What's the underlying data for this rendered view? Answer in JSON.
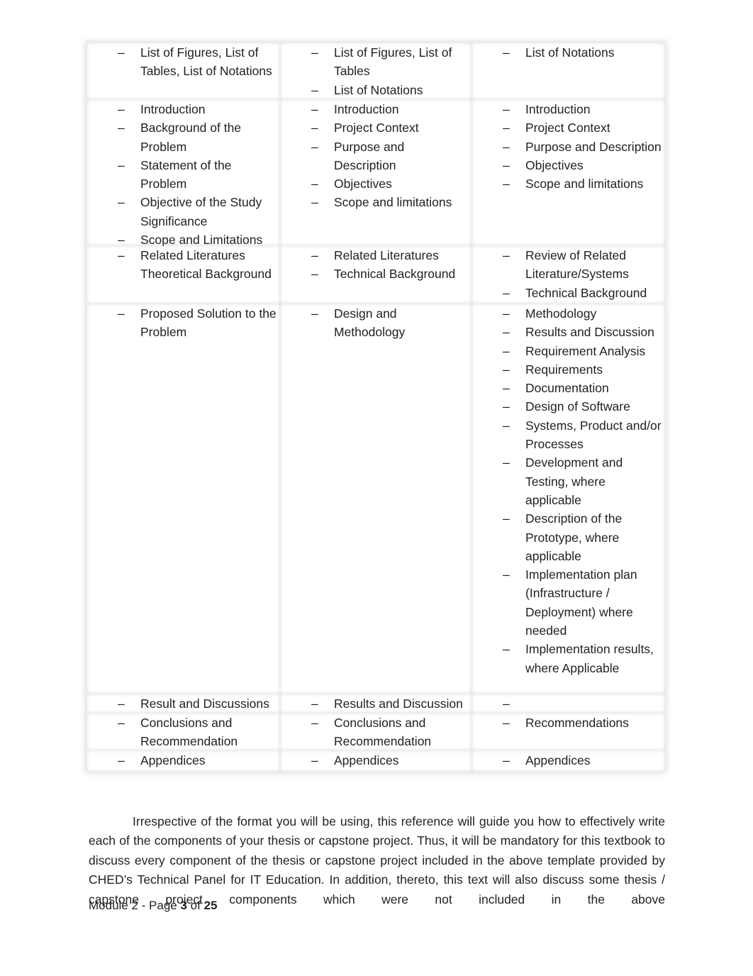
{
  "table": {
    "dash": "–",
    "rows": [
      [
        [
          "List of Figures, List of Tables, List of Notations"
        ],
        [
          "List of Figures, List of Tables",
          "List of Notations"
        ],
        [
          "List of Notations"
        ]
      ],
      [
        [
          "Introduction",
          "Background of the Problem",
          "Statement of the Problem",
          "Objective of the Study Significance",
          "Scope and Limitations"
        ],
        [
          "Introduction",
          "Project Context",
          "Purpose and Description",
          "Objectives",
          "Scope and limitations"
        ],
        [
          "Introduction",
          "Project Context",
          "Purpose and Description",
          "Objectives",
          "Scope and limitations"
        ]
      ],
      [
        [
          "Related Literatures Theoretical Background"
        ],
        [
          "Related Literatures",
          "Technical Background"
        ],
        [
          "Review of Related Literature/Systems",
          "Technical Background"
        ]
      ],
      [
        [
          "Proposed Solution to the Problem"
        ],
        [
          "Design and Methodology"
        ],
        [
          "Methodology",
          "Results and Discussion",
          "Requirement Analysis",
          "Requirements",
          "Documentation",
          "Design of Software",
          "Systems, Product and/or Processes",
          "Development and Testing, where applicable",
          "Description of the Prototype, where applicable",
          "Implementation plan (Infrastructure / Deployment) where needed",
          "Implementation results, where Applicable"
        ]
      ],
      [
        [
          "Result and Discussions"
        ],
        [
          "Results and Discussion"
        ],
        [
          ""
        ]
      ],
      [
        [
          "Conclusions and Recommendation"
        ],
        [
          "Conclusions and Recommendation"
        ],
        [
          "Recommendations"
        ]
      ],
      [
        [
          "Appendices"
        ],
        [
          "Appendices"
        ],
        [
          "Appendices"
        ]
      ]
    ]
  },
  "paragraph": "Irrespective of the format you will be using, this reference will guide you how to effectively write each of the components of your thesis or capstone project. Thus, it will be mandatory for this textbook to discuss every component of the thesis or capstone project included in the above template provided by CHED’s Technical Panel for IT Education. In addition, thereto, this text will also discuss some thesis / capstone project components which were not included in the above",
  "footer": {
    "prefix": "Module 2 - Page ",
    "page": "3",
    "of": " of ",
    "total": "25"
  }
}
